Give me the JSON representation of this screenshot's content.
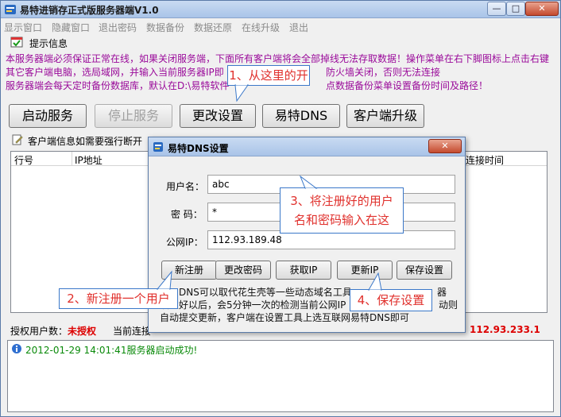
{
  "window": {
    "title": "易特进销存正式版服务器端V1.0",
    "btn_min": "—",
    "btn_max": "□",
    "btn_close": "✕"
  },
  "menu": [
    "显示窗口",
    "隐藏窗口",
    "退出密码",
    "数据备份",
    "数据还原",
    "在线升级",
    "退出"
  ],
  "notice": {
    "label": "提示信息",
    "line1": "本服务器端必须保证正常在线，如果关闭服务端，下面所有客户端将会全部掉线无法存取数据！操作菜单在右下脚图标上点击右键",
    "line2a": "其它客户端电脑，选局域网，并输入当前服务器IP即",
    "line2b": "防火墙关闭，否则无法连接",
    "line3a": "服务器端会每天定时备份数据库，默认在D:\\易特软件",
    "line3b": "点数据备份菜单设置备份时间及路径！"
  },
  "toolbar": {
    "start": "启动服务",
    "stop": "停止服务",
    "settings": "更改设置",
    "dns": "易特DNS",
    "upgrade": "客户端升级"
  },
  "clients": {
    "label": "客户端信息如需要强行断开",
    "columns": [
      "行号",
      "IP地址",
      "连接时间"
    ]
  },
  "status": {
    "licensed_label": "授权用户数：",
    "licensed_value": "未授权",
    "connected_label": "当前连接",
    "ip_value": "112.93.233.1"
  },
  "log": {
    "entry": "2012-01-29 14:01:41服务器启动成功!"
  },
  "dialog": {
    "title": "易特DNS设置",
    "close": "✕",
    "username_label": "用户名：",
    "username_value": "abc",
    "password_label": "密  码：",
    "password_value": "*",
    "ip_label": "公网IP：",
    "ip_value": "112.93.189.48",
    "buttons": [
      "新注册",
      "更改密码",
      "获取IP",
      "更新IP",
      "保存设置"
    ],
    "desc1a": "DNS可以取代花生壳等一些动态域名工具",
    "desc1b": "器",
    "desc2a": "设置好以后，会5分钟一次的检测当前公网IP",
    "desc2b": "动则",
    "desc3": "自动提交更新，客户端在设置工具上选互联网易特DNS即可"
  },
  "callouts": {
    "c1": "1、从这里的开",
    "c2": "2、新注册一个用户",
    "c3a": "3、将注册好的用户",
    "c3b": "名和密码输入在这",
    "c4": "4、保存设置"
  },
  "colors": {
    "notice": "#9a0a9a",
    "callout_text": "#e0302c",
    "callout_border": "#3b78c9",
    "log_text": "#0a8a0a"
  }
}
